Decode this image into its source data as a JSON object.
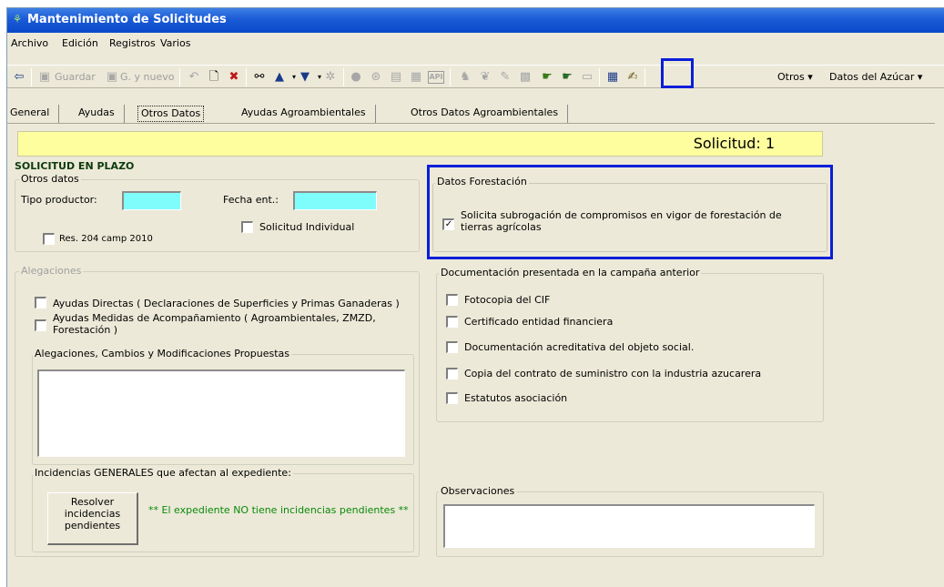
{
  "window": {
    "title": "Mantenimiento de Solicitudes"
  },
  "menu": {
    "archivo": "Archivo",
    "edicion": "Edición",
    "registros": "Registros",
    "varios": "Varios"
  },
  "toolbar": {
    "guardar": "Guardar",
    "g_y_nuevo": "G. y nuevo",
    "otros": "Otros",
    "datos_azucar": "Datos del Azúcar",
    "api_label": "API"
  },
  "tabs": [
    "General",
    "Ayudas",
    "Otros Datos",
    "Ayudas Agroambientales",
    "Otros Datos Agroambientales"
  ],
  "banner": {
    "solicitud": "Solicitud: 1"
  },
  "status": "SOLICITUD EN PLAZO",
  "otros_datos": {
    "legend": "Otros datos",
    "tipo_productor": "Tipo productor:",
    "fecha_ent": "Fecha ent.:",
    "res_204": "Res. 204 camp 2010",
    "solicitud_individual": "Solicitud Individual"
  },
  "forestacion": {
    "legend": "Datos Forestación",
    "subrogacion_line1": "Solicita subrogación de compromisos en vigor de forestación de",
    "subrogacion_line2": "tierras agrícolas",
    "checked": true
  },
  "alegaciones": {
    "legend": "Alegaciones",
    "ayudas_directas": "Ayudas Directas ( Declaraciones de Superficies y Primas Ganaderas )",
    "medidas_line1": "Ayudas Medidas de Acompañamiento ( Agroambientales, ZMZD,",
    "medidas_line2": "Forestación )",
    "cambios_legend": "Alegaciones, Cambios y Modificaciones Propuestas"
  },
  "documentacion": {
    "legend": "Documentación presentada en la campaña anterior",
    "items": [
      "Fotocopia del CIF",
      "Certificado entidad financiera",
      "Documentación acreditativa del objeto social.",
      "Copia del contrato de suministro con la industria azucarera",
      "Estatutos asociación"
    ]
  },
  "incidencias": {
    "legend": "Incidencias GENERALES que afectan al expediente:",
    "button_line1": "Resolver",
    "button_line2": "incidencias",
    "button_line3": "pendientes",
    "message": "** El expediente NO tiene incidencias pendientes **"
  },
  "observaciones": {
    "legend": "Observaciones"
  },
  "colors": {
    "title_blue": "#0a48c9",
    "banner_yellow": "#fefe9e",
    "field_cyan": "#7ffdfd",
    "highlight_blue": "#0a1ed8",
    "status_green": "#0a8a0a"
  }
}
